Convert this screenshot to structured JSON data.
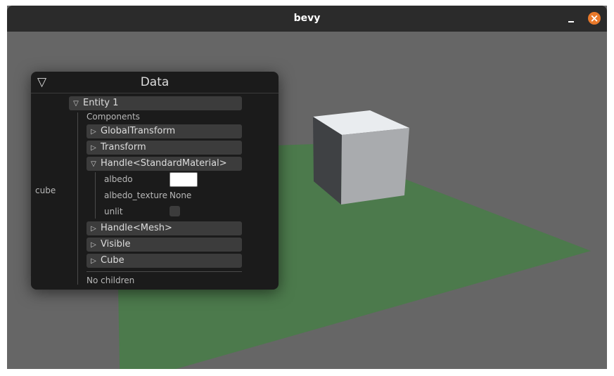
{
  "window": {
    "title": "bevy",
    "minimize_symbol": "–",
    "close_symbol": "×",
    "colors": {
      "titlebar": "#2b2b2b",
      "background": "#666666",
      "ground": "#4c7a4c",
      "close_button": "#e9792a"
    }
  },
  "panel": {
    "title": "Data",
    "collapse_icon": "▽",
    "entity_label": "cube",
    "entity": {
      "arrow": "▽",
      "label": "Entity 1"
    },
    "components_label": "Components",
    "components": [
      {
        "arrow": "▷",
        "label": "GlobalTransform"
      },
      {
        "arrow": "▷",
        "label": "Transform"
      },
      {
        "arrow": "▽",
        "label": "Handle<StandardMaterial>"
      },
      {
        "arrow": "▷",
        "label": "Handle<Mesh>"
      },
      {
        "arrow": "▷",
        "label": "Visible"
      },
      {
        "arrow": "▷",
        "label": "Cube"
      }
    ],
    "material_fields": {
      "albedo_label": "albedo",
      "albedo_color": "#ffffff",
      "albedo_texture_label": "albedo_texture",
      "albedo_texture_value": "None",
      "unlit_label": "unlit",
      "unlit_checked": false
    },
    "children_label": "No children"
  }
}
